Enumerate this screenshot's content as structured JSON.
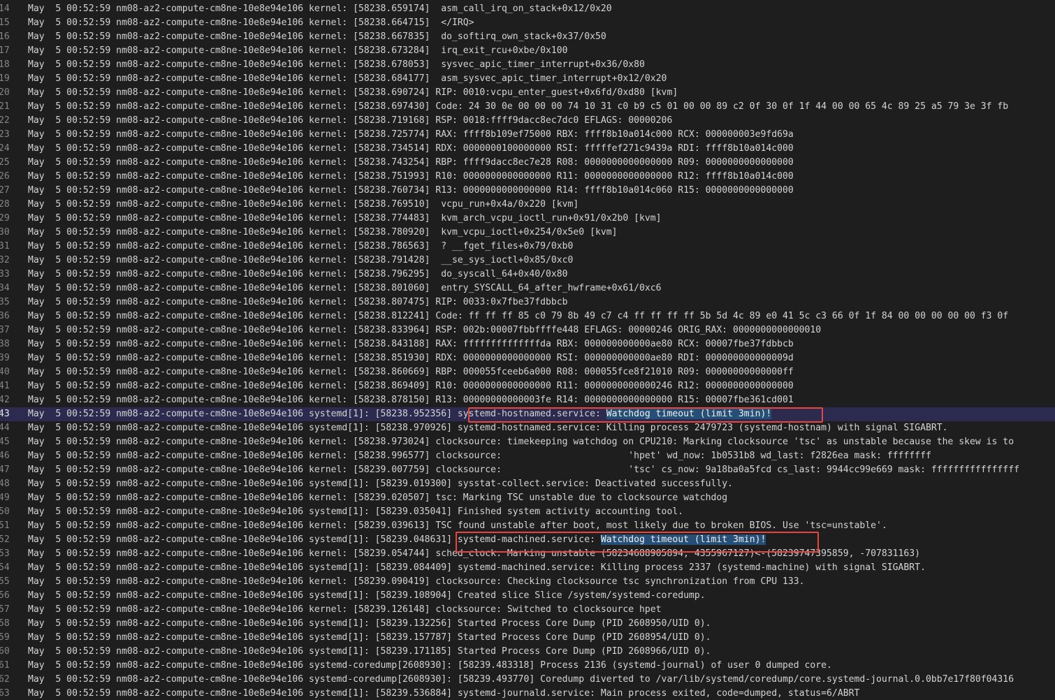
{
  "lines": [
    {
      "num": "14",
      "text": "May  5 00:52:59 nm08-az2-compute-cm8ne-10e8e94e106 kernel: [58238.659174]  asm_call_irq_on_stack+0x12/0x20"
    },
    {
      "num": "15",
      "text": "May  5 00:52:59 nm08-az2-compute-cm8ne-10e8e94e106 kernel: [58238.664715]  </IRQ>"
    },
    {
      "num": "16",
      "text": "May  5 00:52:59 nm08-az2-compute-cm8ne-10e8e94e106 kernel: [58238.667835]  do_softirq_own_stack+0x37/0x50"
    },
    {
      "num": "17",
      "text": "May  5 00:52:59 nm08-az2-compute-cm8ne-10e8e94e106 kernel: [58238.673284]  irq_exit_rcu+0xbe/0x100"
    },
    {
      "num": "18",
      "text": "May  5 00:52:59 nm08-az2-compute-cm8ne-10e8e94e106 kernel: [58238.678053]  sysvec_apic_timer_interrupt+0x36/0x80"
    },
    {
      "num": "19",
      "text": "May  5 00:52:59 nm08-az2-compute-cm8ne-10e8e94e106 kernel: [58238.684177]  asm_sysvec_apic_timer_interrupt+0x12/0x20"
    },
    {
      "num": "20",
      "text": "May  5 00:52:59 nm08-az2-compute-cm8ne-10e8e94e106 kernel: [58238.690724] RIP: 0010:vcpu_enter_guest+0x6fd/0xd80 [kvm]"
    },
    {
      "num": "21",
      "text": "May  5 00:52:59 nm08-az2-compute-cm8ne-10e8e94e106 kernel: [58238.697430] Code: 24 30 0e 00 00 00 74 10 31 c0 b9 c5 01 00 00 89 c2 0f 30 0f 1f 44 00 00 65 4c 89 25 a5 79 3e 3f fb"
    },
    {
      "num": "22",
      "text": "May  5 00:52:59 nm08-az2-compute-cm8ne-10e8e94e106 kernel: [58238.719168] RSP: 0018:ffff9dacc8ec7dc0 EFLAGS: 00000206"
    },
    {
      "num": "23",
      "text": "May  5 00:52:59 nm08-az2-compute-cm8ne-10e8e94e106 kernel: [58238.725774] RAX: ffff8b109ef75000 RBX: ffff8b10a014c000 RCX: 000000003e9fd69a"
    },
    {
      "num": "24",
      "text": "May  5 00:52:59 nm08-az2-compute-cm8ne-10e8e94e106 kernel: [58238.734514] RDX: 0000000100000000 RSI: fffffef271c9439a RDI: ffff8b10a014c000"
    },
    {
      "num": "25",
      "text": "May  5 00:52:59 nm08-az2-compute-cm8ne-10e8e94e106 kernel: [58238.743254] RBP: ffff9dacc8ec7e28 R08: 0000000000000000 R09: 0000000000000000"
    },
    {
      "num": "26",
      "text": "May  5 00:52:59 nm08-az2-compute-cm8ne-10e8e94e106 kernel: [58238.751993] R10: 0000000000000000 R11: 0000000000000000 R12: ffff8b10a014c000"
    },
    {
      "num": "27",
      "text": "May  5 00:52:59 nm08-az2-compute-cm8ne-10e8e94e106 kernel: [58238.760734] R13: 0000000000000000 R14: ffff8b10a014c060 R15: 0000000000000000"
    },
    {
      "num": "28",
      "text": "May  5 00:52:59 nm08-az2-compute-cm8ne-10e8e94e106 kernel: [58238.769510]  vcpu_run+0x4a/0x220 [kvm]"
    },
    {
      "num": "29",
      "text": "May  5 00:52:59 nm08-az2-compute-cm8ne-10e8e94e106 kernel: [58238.774483]  kvm_arch_vcpu_ioctl_run+0x91/0x2b0 [kvm]"
    },
    {
      "num": "30",
      "text": "May  5 00:52:59 nm08-az2-compute-cm8ne-10e8e94e106 kernel: [58238.780920]  kvm_vcpu_ioctl+0x254/0x5e0 [kvm]"
    },
    {
      "num": "31",
      "text": "May  5 00:52:59 nm08-az2-compute-cm8ne-10e8e94e106 kernel: [58238.786563]  ? __fget_files+0x79/0xb0"
    },
    {
      "num": "32",
      "text": "May  5 00:52:59 nm08-az2-compute-cm8ne-10e8e94e106 kernel: [58238.791428]  __se_sys_ioctl+0x85/0xc0"
    },
    {
      "num": "33",
      "text": "May  5 00:52:59 nm08-az2-compute-cm8ne-10e8e94e106 kernel: [58238.796295]  do_syscall_64+0x40/0x80"
    },
    {
      "num": "34",
      "text": "May  5 00:52:59 nm08-az2-compute-cm8ne-10e8e94e106 kernel: [58238.801060]  entry_SYSCALL_64_after_hwframe+0x61/0xc6"
    },
    {
      "num": "35",
      "text": "May  5 00:52:59 nm08-az2-compute-cm8ne-10e8e94e106 kernel: [58238.807475] RIP: 0033:0x7fbe37fdbbcb"
    },
    {
      "num": "36",
      "text": "May  5 00:52:59 nm08-az2-compute-cm8ne-10e8e94e106 kernel: [58238.812241] Code: ff ff ff 85 c0 79 8b 49 c7 c4 ff ff ff ff 5b 5d 4c 89 e0 41 5c c3 66 0f 1f 84 00 00 00 00 00 f3 0f"
    },
    {
      "num": "37",
      "text": "May  5 00:52:59 nm08-az2-compute-cm8ne-10e8e94e106 kernel: [58238.833964] RSP: 002b:00007fbbffffe448 EFLAGS: 00000246 ORIG_RAX: 0000000000000010"
    },
    {
      "num": "38",
      "text": "May  5 00:52:59 nm08-az2-compute-cm8ne-10e8e94e106 kernel: [58238.843188] RAX: ffffffffffffffda RBX: 000000000000ae80 RCX: 00007fbe37fdbbcb"
    },
    {
      "num": "39",
      "text": "May  5 00:52:59 nm08-az2-compute-cm8ne-10e8e94e106 kernel: [58238.851930] RDX: 0000000000000000 RSI: 000000000000ae80 RDI: 000000000000009d"
    },
    {
      "num": "40",
      "text": "May  5 00:52:59 nm08-az2-compute-cm8ne-10e8e94e106 kernel: [58238.860669] RBP: 000055fceeb6a000 R08: 000055fce8f21010 R09: 00000000000000ff"
    },
    {
      "num": "41",
      "text": "May  5 00:52:59 nm08-az2-compute-cm8ne-10e8e94e106 kernel: [58238.869409] R10: 0000000000000000 R11: 0000000000000246 R12: 0000000000000000"
    },
    {
      "num": "42",
      "text": "May  5 00:52:59 nm08-az2-compute-cm8ne-10e8e94e106 kernel: [58238.878150] R13: 00000000000003fe R14: 0000000000000000 R15: 00007fbe361cd001"
    },
    {
      "num": "43",
      "text": "May  5 00:52:59 nm08-az2-compute-cm8ne-10e8e94e106 systemd[1]: [58238.952356] systemd-hostnamed.service: ",
      "selected": "Watchdog timeout (limit 3min)!",
      "current": true
    },
    {
      "num": "44",
      "text": "May  5 00:52:59 nm08-az2-compute-cm8ne-10e8e94e106 systemd[1]: [58238.970926] systemd-hostnamed.service: Killing process 2479723 (systemd-hostnam) with signal SIGABRT."
    },
    {
      "num": "45",
      "text": "May  5 00:52:59 nm08-az2-compute-cm8ne-10e8e94e106 kernel: [58238.973024] clocksource: timekeeping watchdog on CPU210: Marking clocksource 'tsc' as unstable because the skew is to"
    },
    {
      "num": "46",
      "text": "May  5 00:52:59 nm08-az2-compute-cm8ne-10e8e94e106 kernel: [58238.996577] clocksource:                       'hpet' wd_now: 1b0531b8 wd_last: f2826ea mask: ffffffff"
    },
    {
      "num": "47",
      "text": "May  5 00:52:59 nm08-az2-compute-cm8ne-10e8e94e106 kernel: [58239.007759] clocksource:                       'tsc' cs_now: 9a18ba0a5fcd cs_last: 9944cc99e669 mask: ffffffffffffffff"
    },
    {
      "num": "48",
      "text": "May  5 00:52:59 nm08-az2-compute-cm8ne-10e8e94e106 systemd[1]: [58239.019300] sysstat-collect.service: Deactivated successfully."
    },
    {
      "num": "49",
      "text": "May  5 00:52:59 nm08-az2-compute-cm8ne-10e8e94e106 kernel: [58239.020507] tsc: Marking TSC unstable due to clocksource watchdog"
    },
    {
      "num": "50",
      "text": "May  5 00:52:59 nm08-az2-compute-cm8ne-10e8e94e106 systemd[1]: [58239.035041] Finished system activity accounting tool."
    },
    {
      "num": "51",
      "text": "May  5 00:52:59 nm08-az2-compute-cm8ne-10e8e94e106 kernel: [58239.039613] TSC found unstable after boot, most likely due to broken BIOS. Use 'tsc=unstable'."
    },
    {
      "num": "52",
      "text": "May  5 00:52:59 nm08-az2-compute-cm8ne-10e8e94e106 systemd[1]: [58239.048631] systemd-machined.service: ",
      "selected": "Watchdog timeout (limit 3min)!"
    },
    {
      "num": "53",
      "text": "May  5 00:52:59 nm08-az2-compute-cm8ne-10e8e94e106 kernel: [58239.054744] sched_clock: Marking unstable (58234688905894, 4355967127)<-(58239747395859, -707831163)"
    },
    {
      "num": "54",
      "text": "May  5 00:52:59 nm08-az2-compute-cm8ne-10e8e94e106 systemd[1]: [58239.084409] systemd-machined.service: Killing process 2337 (systemd-machine) with signal SIGABRT."
    },
    {
      "num": "55",
      "text": "May  5 00:52:59 nm08-az2-compute-cm8ne-10e8e94e106 kernel: [58239.090419] clocksource: Checking clocksource tsc synchronization from CPU 133."
    },
    {
      "num": "56",
      "text": "May  5 00:52:59 nm08-az2-compute-cm8ne-10e8e94e106 systemd[1]: [58239.108904] Created slice Slice /system/systemd-coredump."
    },
    {
      "num": "57",
      "text": "May  5 00:52:59 nm08-az2-compute-cm8ne-10e8e94e106 kernel: [58239.126148] clocksource: Switched to clocksource hpet"
    },
    {
      "num": "58",
      "text": "May  5 00:52:59 nm08-az2-compute-cm8ne-10e8e94e106 systemd[1]: [58239.132256] Started Process Core Dump (PID 2608950/UID 0)."
    },
    {
      "num": "59",
      "text": "May  5 00:52:59 nm08-az2-compute-cm8ne-10e8e94e106 systemd[1]: [58239.157787] Started Process Core Dump (PID 2608954/UID 0)."
    },
    {
      "num": "60",
      "text": "May  5 00:52:59 nm08-az2-compute-cm8ne-10e8e94e106 systemd[1]: [58239.171185] Started Process Core Dump (PID 2608966/UID 0)."
    },
    {
      "num": "61",
      "text": "May  5 00:52:59 nm08-az2-compute-cm8ne-10e8e94e106 systemd-coredump[2608930]: [58239.483318] Process 2136 (systemd-journal) of user 0 dumped core."
    },
    {
      "num": "62",
      "text": "May  5 00:52:59 nm08-az2-compute-cm8ne-10e8e94e106 systemd-coredump[2608930]: [58239.493770] Coredump diverted to /var/lib/systemd/coredump/core.systemd-journal.0.0bb7e17f80f04316"
    },
    {
      "num": "63",
      "text": "May  5 00:52:59 nm08-az2-compute-cm8ne-10e8e94e106 systemd[1]: [58239.536884] systemd-journald.service: Main process exited, code=dumped, status=6/ABRT"
    }
  ],
  "theme": {
    "background": "#1e1e1e",
    "text": "#d4d4d4",
    "line_number": "#858585",
    "current_line": "#2c2a4f",
    "selection": "#264f78",
    "annotation_box": "#e8453c"
  }
}
